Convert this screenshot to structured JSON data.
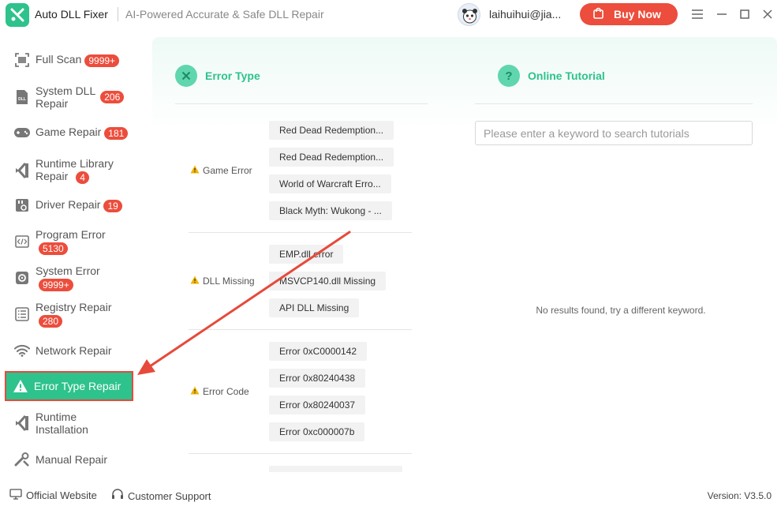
{
  "app": {
    "title": "Auto DLL Fixer",
    "subtitle": "AI-Powered Accurate & Safe DLL Repair",
    "username": "laihuihui@jia...",
    "buy_now": "Buy Now"
  },
  "sidebar": {
    "items": [
      {
        "label": "Full Scan",
        "badge": "9999+",
        "icon": "scan-icon"
      },
      {
        "label": "System DLL",
        "label2": "Repair",
        "badge": "206",
        "icon": "dll-icon"
      },
      {
        "label": "Game Repair",
        "badge": "181",
        "icon": "gamepad-icon"
      },
      {
        "label": "Runtime Library",
        "label2": "Repair",
        "badge": "4",
        "icon": "runtime-icon"
      },
      {
        "label": "Driver Repair",
        "badge": "19",
        "icon": "driver-icon"
      },
      {
        "label": "Program Error",
        "badge": "5130",
        "icon": "code-icon"
      },
      {
        "label": "System Error",
        "badge": "9999+",
        "icon": "gear-icon"
      },
      {
        "label": "Registry Repair",
        "badge": "280",
        "icon": "registry-icon"
      },
      {
        "label": "Network Repair",
        "icon": "wifi-icon"
      },
      {
        "label": "Error Type Repair",
        "icon": "warning-icon",
        "active": true
      },
      {
        "label": "Runtime",
        "label2": "Installation",
        "icon": "install-icon"
      },
      {
        "label": "Manual Repair",
        "icon": "wrench-icon"
      }
    ]
  },
  "main": {
    "error_type_title": "Error Type",
    "tutorial_title": "Online Tutorial",
    "search_placeholder": "Please enter a keyword to search tutorials",
    "no_results": "No results found, try a different keyword.",
    "groups": [
      {
        "label": "Game Error",
        "items": [
          "Red Dead Redemption...",
          "Red Dead Redemption...",
          "World of Warcraft Erro...",
          "Black Myth: Wukong - ..."
        ]
      },
      {
        "label": "DLL Missing",
        "items": [
          "EMP.dll error",
          "MSVCP140.dll Missing",
          "API DLL Missing"
        ]
      },
      {
        "label": "Error Code",
        "items": [
          "Error 0xC0000142",
          "Error 0x80240438",
          "Error 0x80240037",
          "Error 0xc000007b"
        ]
      }
    ]
  },
  "footer": {
    "official_website": "Official Website",
    "customer_support": "Customer Support",
    "version": "Version: V3.5.0"
  },
  "colors": {
    "accent": "#2ec28d",
    "badge": "#ec4d3c",
    "annotation": "#e64a3b"
  }
}
